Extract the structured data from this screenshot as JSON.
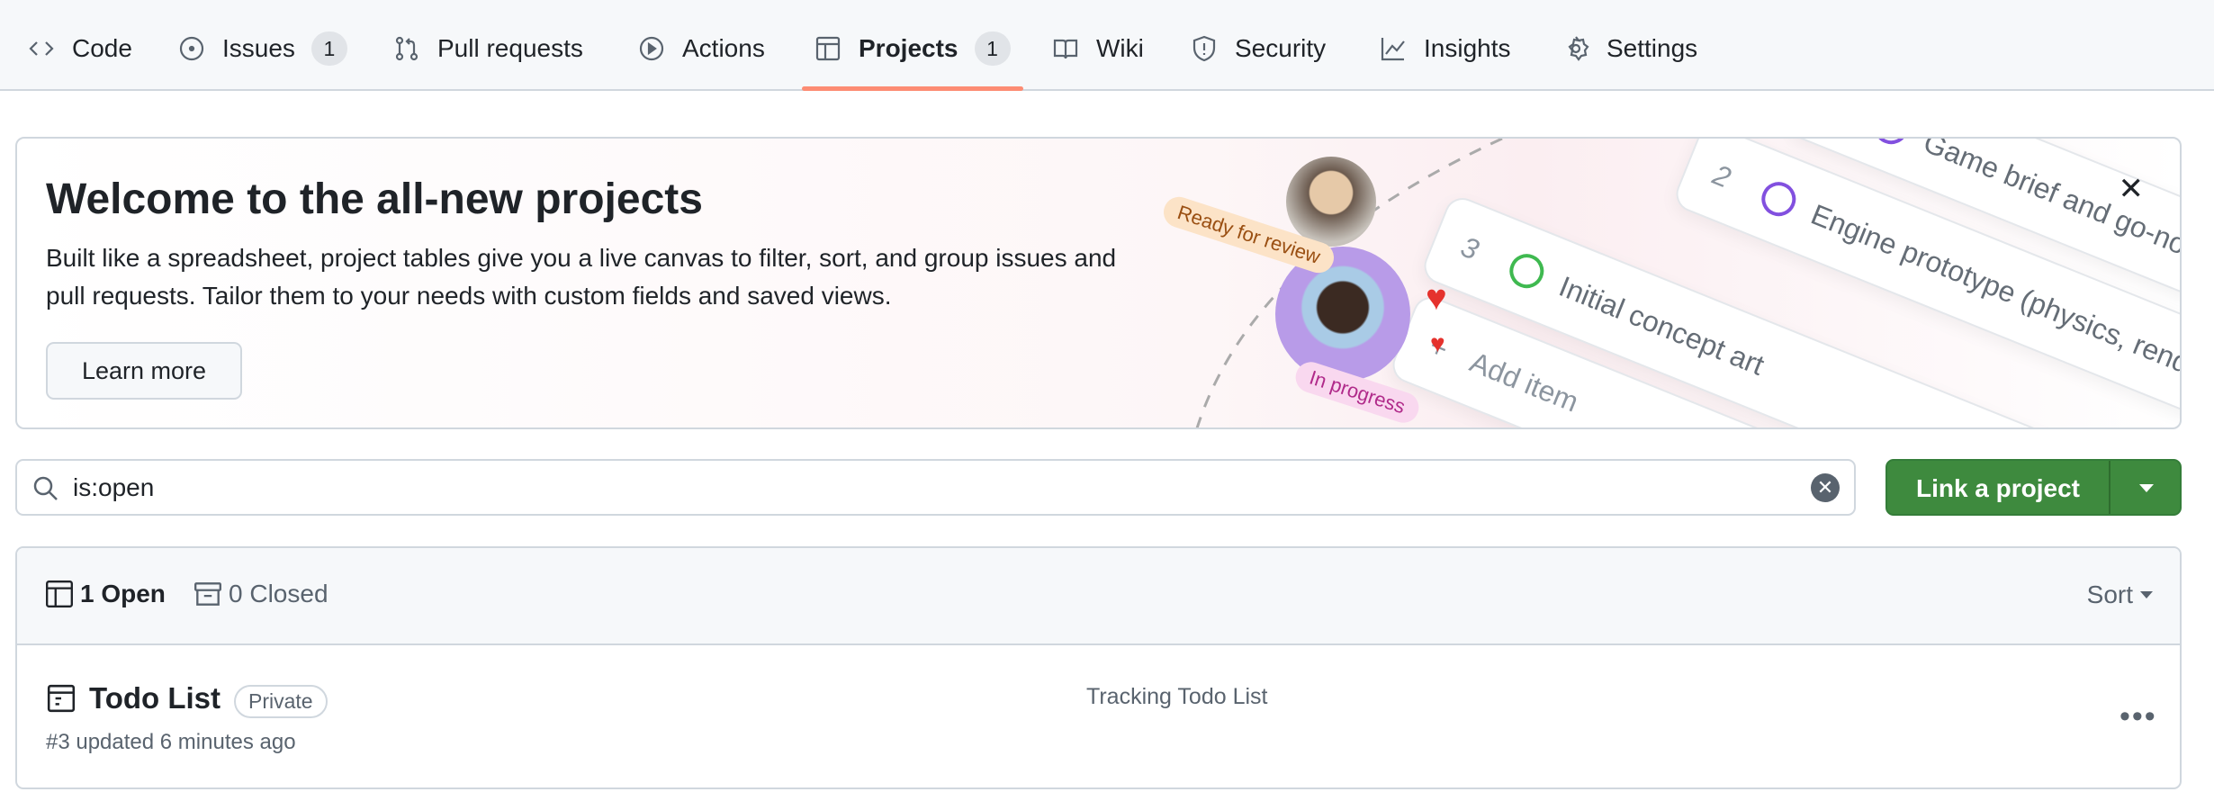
{
  "nav": {
    "tabs": [
      {
        "label": "Code",
        "icon": "code-icon"
      },
      {
        "label": "Issues",
        "icon": "issue-icon",
        "count": "1"
      },
      {
        "label": "Pull requests",
        "icon": "pull-request-icon"
      },
      {
        "label": "Actions",
        "icon": "play-icon"
      },
      {
        "label": "Projects",
        "icon": "table-icon",
        "count": "1",
        "selected": true
      },
      {
        "label": "Wiki",
        "icon": "book-icon"
      },
      {
        "label": "Security",
        "icon": "shield-icon"
      },
      {
        "label": "Insights",
        "icon": "graph-icon"
      },
      {
        "label": "Settings",
        "icon": "gear-icon"
      }
    ]
  },
  "banner": {
    "title": "Welcome to the all-new projects",
    "description": "Built like a spreadsheet, project tables give you a live canvas to filter, sort, and group issues and pull requests. Tailor them to your needs with custom fields and saved views.",
    "learn_more": "Learn more",
    "illustration": {
      "ready_label": "Ready for review",
      "progress_label": "In progress",
      "items": [
        {
          "num": "1",
          "text": "Game brief and go-no-go"
        },
        {
          "num": "2",
          "text": "Engine prototype (physics, rendering)"
        },
        {
          "num": "3",
          "text": "Initial concept art"
        }
      ],
      "add_item": "Add item"
    }
  },
  "search": {
    "value": "is:open"
  },
  "link_project": "Link a project",
  "list": {
    "open": "1 Open",
    "closed": "0 Closed",
    "sort": "Sort",
    "projects": [
      {
        "title": "Todo List",
        "visibility": "Private",
        "subtitle": "#3 updated 6 minutes ago",
        "description": "Tracking Todo List"
      }
    ]
  },
  "colors": {
    "accent_underline": "#fd8c73",
    "primary_button": "#3e8a3e"
  }
}
